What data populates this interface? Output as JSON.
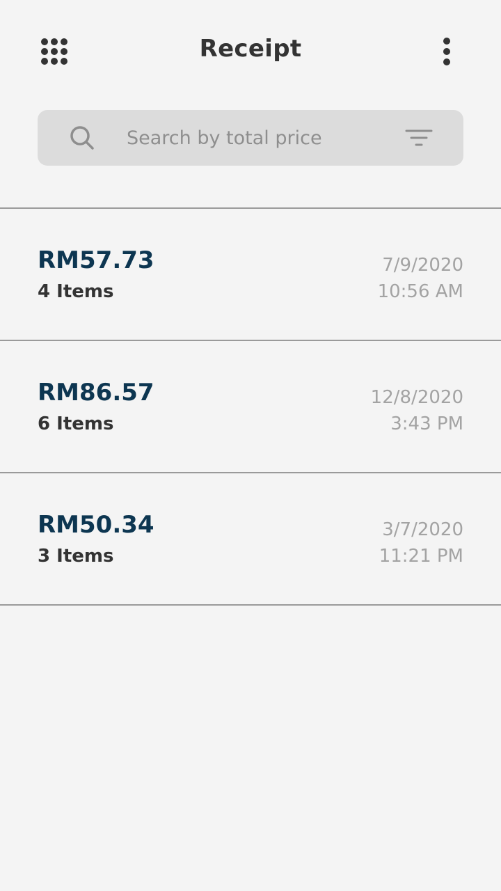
{
  "header": {
    "title": "Receipt",
    "left_icon": "grid-menu-icon",
    "right_icon": "more-vertical-icon"
  },
  "search": {
    "placeholder": "Search by total price",
    "value": "",
    "search_icon": "search-icon",
    "filter_icon": "filter-icon"
  },
  "receipts": [
    {
      "total": "RM57.73",
      "items": "4 Items",
      "date": "7/9/2020",
      "time": "10:56 AM"
    },
    {
      "total": "RM86.57",
      "items": "6 Items",
      "date": "12/8/2020",
      "time": "3:43 PM"
    },
    {
      "total": "RM50.34",
      "items": "3 Items",
      "date": "3/7/2020",
      "time": "11:21 PM"
    }
  ],
  "colors": {
    "background": "#f4f4f4",
    "price": "#0d3651",
    "search_bg": "#dcdcdc",
    "muted": "#a3a3a3"
  }
}
